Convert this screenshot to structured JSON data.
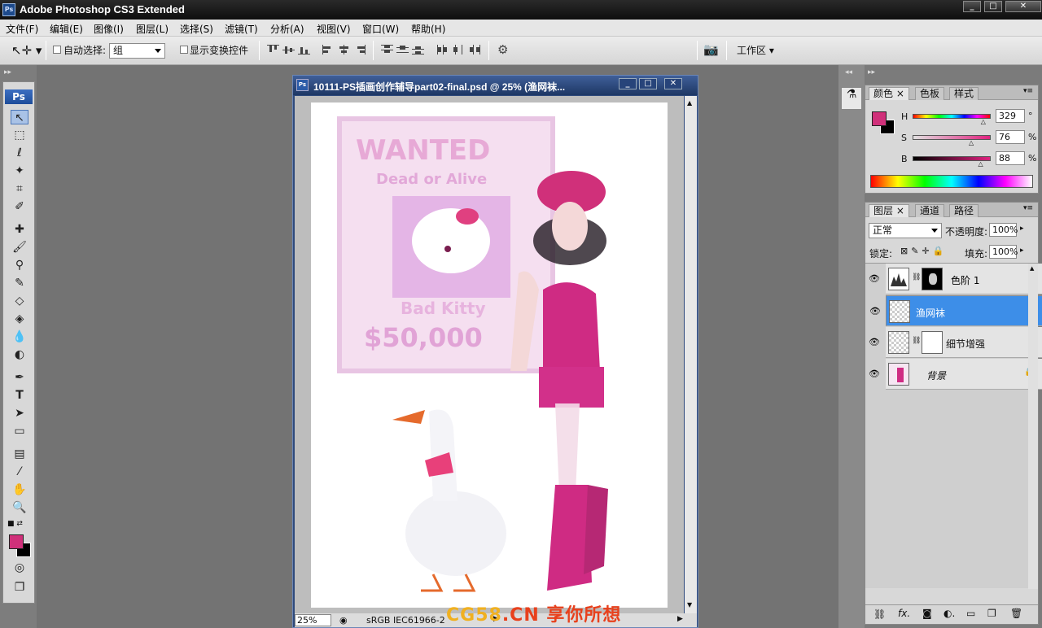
{
  "app": {
    "title": "Adobe Photoshop CS3 Extended",
    "logo": "Ps"
  },
  "window_controls": [
    "_",
    "□",
    "✕"
  ],
  "menu": [
    "文件(F)",
    "编辑(E)",
    "图像(I)",
    "图层(L)",
    "选择(S)",
    "滤镜(T)",
    "分析(A)",
    "视图(V)",
    "窗口(W)",
    "帮助(H)"
  ],
  "options": {
    "auto_select_label": "自动选择:",
    "auto_select_value": "组",
    "show_transform_label": "显示变换控件",
    "workspace_label": "工作区"
  },
  "toolbox": {
    "logo": "Ps",
    "fg_color": "#d0307a",
    "bg_color": "#000000"
  },
  "document": {
    "title": "10111-PS插画创作辅导part02-final.psd @ 25% (渔网袜...",
    "icon": "Ps",
    "zoom": "25%",
    "profile": "sRGB IEC61966-2",
    "poster": {
      "title": "WANTED",
      "subtitle": "Dead or Alive",
      "name": "Bad Kitty",
      "reward": "$50,000"
    }
  },
  "color_panel": {
    "tabs": [
      "颜色",
      "色板",
      "样式"
    ],
    "h_label": "H",
    "h_value": "329",
    "h_unit": "°",
    "s_label": "S",
    "s_value": "76",
    "s_unit": "%",
    "b_label": "B",
    "b_value": "88",
    "b_unit": "%",
    "fg": "#d0307a",
    "bg": "#000000",
    "h_level": 0.914,
    "s_level": 0.76,
    "b_level": 0.88
  },
  "layers_panel": {
    "tabs": [
      "图层",
      "通道",
      "路径"
    ],
    "blend_mode": "正常",
    "opacity_label": "不透明度:",
    "opacity": "100%",
    "lock_label": "锁定:",
    "fill_label": "填充:",
    "fill": "100%",
    "layers": [
      {
        "name": "色阶 1",
        "selected": false
      },
      {
        "name": "渔网袜",
        "selected": true
      },
      {
        "name": "细节增强",
        "selected": false
      },
      {
        "name": "背景",
        "selected": false
      }
    ]
  },
  "watermark": {
    "left": "CG58",
    "mid": ".CN",
    "right": "享你所想"
  }
}
